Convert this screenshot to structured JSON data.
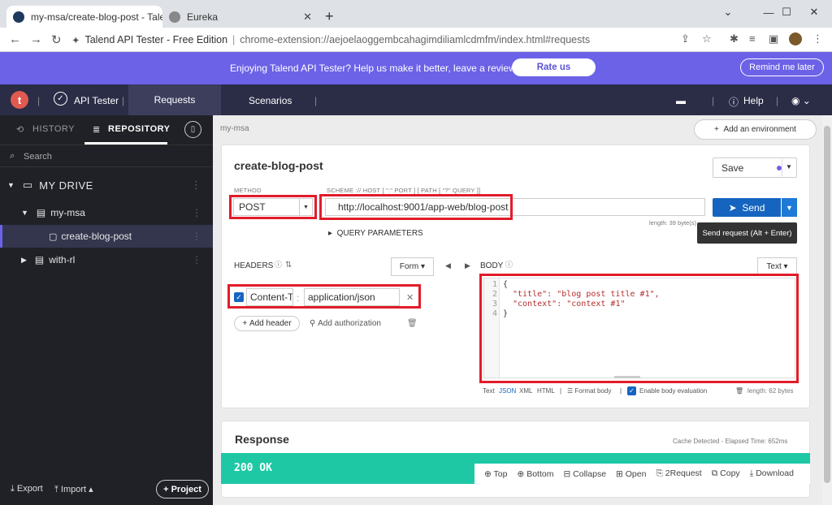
{
  "browser": {
    "tabs": [
      {
        "title": "my-msa/create-blog-post - Tale",
        "active": true
      },
      {
        "title": "Eureka",
        "active": false
      }
    ],
    "new_tab": "+",
    "window_controls": {
      "collapse": "⌄",
      "minimize": "—",
      "maximize": "☐",
      "close": "✕"
    },
    "address": {
      "site_name": "Talend API Tester - Free Edition",
      "separator": "|",
      "url": "chrome-extension://aejoelaoggembcahagimdiliamlcdmfm/index.html#requests"
    }
  },
  "banner": {
    "message": "Enjoying Talend API Tester? Help us make it better, leave a review!",
    "rate_label": "Rate us",
    "remind_label": "Remind me later"
  },
  "appbar": {
    "logo": "t",
    "product": "API Tester",
    "tabs": [
      "Requests",
      "Scenarios"
    ],
    "help": "Help"
  },
  "sidebar": {
    "history_label": "HISTORY",
    "repository_label": "REPOSITORY",
    "search_placeholder": "Search",
    "drive_label": "MY DRIVE",
    "tree": [
      {
        "label": "my-msa"
      },
      {
        "label": "create-blog-post"
      },
      {
        "label": "with-rl"
      }
    ],
    "export_label": "Export",
    "import_label": "Import",
    "project_label": "Project"
  },
  "main": {
    "breadcrumb": "my-msa",
    "add_env_label": "Add an environment",
    "request_name": "create-blog-post",
    "save_label": "Save",
    "method_label": "METHOD",
    "method_value": "POST",
    "scheme_label": "SCHEME :// HOST [ \":\" PORT ] [ PATH [ \"?\" QUERY ]]",
    "url_value": "http://localhost:9001/app-web/blog-post",
    "length_text": "length: 39 byte(s)",
    "send_label": "Send",
    "tooltip": "Send request (Alt + Enter)",
    "query_params_label": "QUERY PARAMETERS",
    "headers_label": "HEADERS",
    "form_label": "Form",
    "header_name": "Content-T",
    "header_value": "application/json",
    "add_header_label": "Add header",
    "add_auth_label": "Add authorization",
    "body_label": "BODY",
    "text_label": "Text",
    "body_lines": [
      {
        "num": "1",
        "text": "{"
      },
      {
        "num": "2",
        "key": "\"title\"",
        "val": "\"blog post title #1\","
      },
      {
        "num": "3",
        "key": "\"context\"",
        "val": "\"context #1\""
      },
      {
        "num": "4",
        "text": "}"
      }
    ],
    "body_footer": {
      "formats": [
        "Text",
        "JSON",
        "XML",
        "HTML"
      ],
      "format_body": "Format body",
      "enable_eval": "Enable body evaluation",
      "length": "length: 62 bytes"
    }
  },
  "response": {
    "title": "Response",
    "cache_text": "Cache Detected - Elapsed Time: 652ms",
    "status": "200 OK",
    "tools": [
      "Top",
      "Bottom",
      "Collapse",
      "Open",
      "2Request",
      "Copy",
      "Download"
    ]
  },
  "colors": {
    "accent": "#6c62e7",
    "appbar": "#2b2d47",
    "send": "#1565c0",
    "status_ok": "#1ec8a5",
    "highlight": "#e11c2a"
  }
}
